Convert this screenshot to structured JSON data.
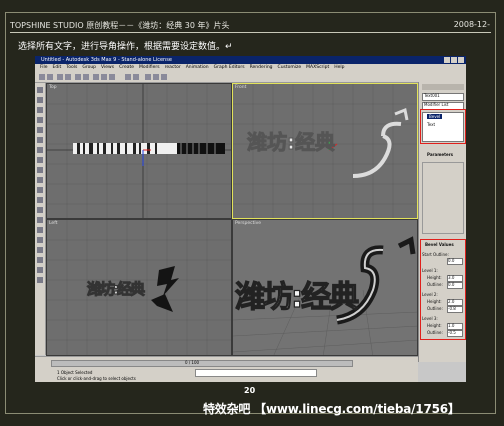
{
  "header": {
    "left": "TOPSHINE STUDIO 原创教程－－《潍坊：经典 30 年》片头",
    "right": "2008-12-"
  },
  "instruction": "选择所有文字，进行导角操作，根据需要设定数值。↵",
  "app": {
    "title": "Untitled - Autodesk 3ds Max 9 - Stand-alone License",
    "menu": [
      "File",
      "Edit",
      "Tools",
      "Group",
      "Views",
      "Create",
      "Modifiers",
      "reactor",
      "Animation",
      "Graph Editors",
      "Rendering",
      "Customize",
      "MAXScript",
      "Help"
    ],
    "viewports": {
      "top": "Top",
      "front": "Front",
      "left": "Left",
      "perspective": "Perspective"
    },
    "viewport_text": "潍坊:经典",
    "command_panel": {
      "selection": "Text001",
      "modifier_list": "Modifier List",
      "stack_items": [
        "Bevel",
        "Text"
      ],
      "params_title": "Parameters",
      "bevel_values_title": "Bevel Values",
      "start_outline_label": "Start Outline:",
      "start_outline_value": "0.0",
      "level_labels": [
        "Level 1:",
        "Level 2:",
        "Level 3:"
      ],
      "height_label": "Height:",
      "outline_label": "Outline:",
      "height_values": [
        "3.0",
        "2.0",
        "1.0"
      ],
      "outline_values": [
        "0.0",
        "-0.8",
        "-0.5"
      ]
    },
    "status": {
      "frame": "0 / 100",
      "message": "Click or click-and-drag to select objects",
      "selected": "1 Object Selected"
    }
  },
  "footer": {
    "page_number": "20",
    "credit": "特效杂吧 【www.linecg.com/tieba/1756】"
  },
  "colors": {
    "background": "#25261c",
    "highlight_box": "#e0201c",
    "active_viewport": "#e3e35a",
    "viewport_bg": "#6e6e6e"
  }
}
